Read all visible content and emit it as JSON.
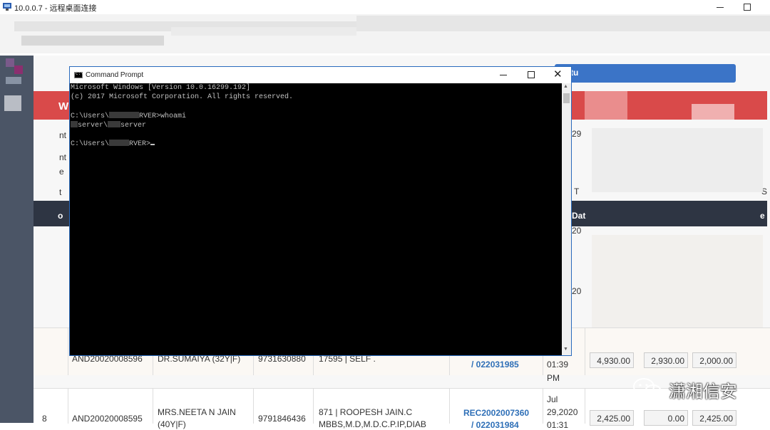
{
  "rdp": {
    "title": "10.0.0.7 - 远程桌面连接"
  },
  "background_app": {
    "colors": {
      "sidebar": "#4b5566",
      "header_red": "#d94a4a",
      "header_blue": "#3b74c7",
      "table_header": "#2e3543"
    },
    "partial_labels": [
      "W",
      "nt",
      "nt",
      "e",
      "t",
      "o",
      "tu",
      "29",
      "T",
      "S",
      "Dat",
      "e",
      "20",
      "20",
      "20"
    ],
    "rows": [
      {
        "no": "",
        "id": "AND20020008596",
        "patient": "DR.SUMAIYA (32Y|F)",
        "phone": "9731630880",
        "ref": "17595 | SELF .",
        "receipt": "/ 022031985",
        "date": [
          "01:39",
          "PM"
        ],
        "amounts": [
          "4,930.00",
          "2,930.00",
          "2,000.00"
        ]
      },
      {
        "no": "8",
        "id": "AND20020008595",
        "patient": "MRS.NEETA N JAIN",
        "patient2": "(40Y|F)",
        "phone": "9791846436",
        "ref": "871 | ROOPESH JAIN.C",
        "ref2": "MBBS,M.D,M.D.C.P.IP,DIAB",
        "receipt": "REC2002007360",
        "receipt2": "/ 022031984",
        "date": [
          "Jul",
          "29,2020",
          "01:31"
        ],
        "amounts": [
          "2,425.00",
          "0.00",
          "2,425.00"
        ]
      }
    ]
  },
  "cmd": {
    "title": "Command Prompt",
    "icon_label": "C:\\",
    "lines": {
      "l1": "Microsoft Windows [Version 10.0.16299.192]",
      "l2": "(c) 2017 Microsoft Corporation. All rights reserved.",
      "p1a": "C:\\Users\\",
      "p1b": "RVER>whoami",
      "o1a": "server\\",
      "o1b": "server",
      "p2a": "C:\\Users\\",
      "p2b": "RVER>"
    }
  },
  "watermark": {
    "text": "潇湘信安",
    "icon": "wechat-icon"
  }
}
